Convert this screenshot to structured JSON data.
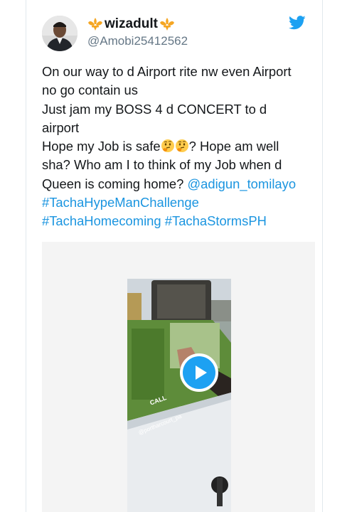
{
  "tweet": {
    "display_name": "wizadult",
    "handle": "@Amobi25412562",
    "lines": {
      "l1": "On our way to d Airport rite nw even Airport",
      "l2": "no go contain us",
      "l3": "Just jam my BOSS 4 d CONCERT to d",
      "l4": "airport",
      "l5a": "Hope my Job is safe",
      "l5b": "? Hope am well",
      "l6": "sha? Who am I to think of my Job when d",
      "l7": "Queen is coming home? ",
      "mention": "@adigun_tomilayo",
      "tag1": "#TachaHypeManChallenge",
      "tag2": "#TachaHomecoming",
      "tag3": "#TachaStormsPH"
    }
  },
  "media": {
    "banner_text": "CALL",
    "watermark": "@portharcourt_pa"
  },
  "icons": {
    "brand": "twitter-bird-icon",
    "emoji": "thinking-face-emoji",
    "crown": "fleur-de-lis-icon",
    "play": "play-icon"
  },
  "colors": {
    "link": "#1b95e0",
    "twitter_blue": "#1da1f2",
    "handle_gray": "#657786"
  }
}
